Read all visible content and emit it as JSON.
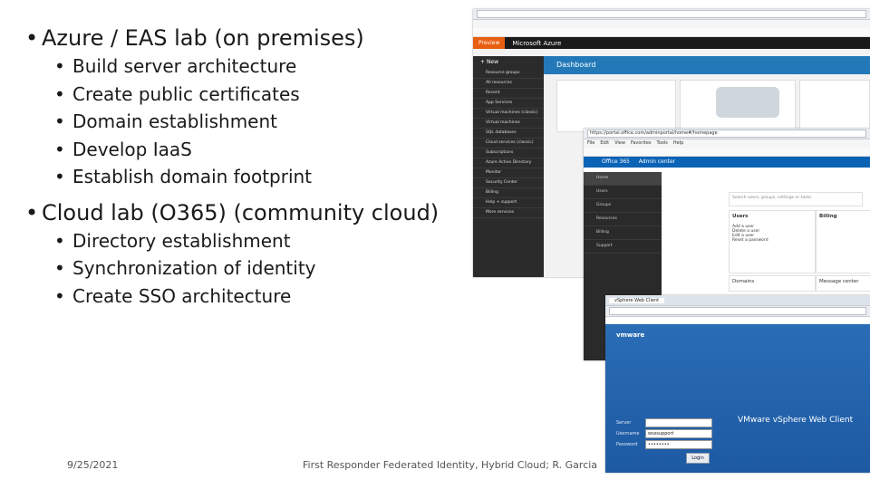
{
  "slide": {
    "bullet1": "Azure / EAS lab (on premises)",
    "sub1": [
      "Build server architecture",
      "Create public certificates",
      "Domain establishment",
      "Develop IaaS",
      "Establish domain footprint"
    ],
    "bullet2": "Cloud lab (O365) (community cloud)",
    "sub2": [
      "Directory establishment",
      "Synchronization of identity",
      "Create SSO architecture"
    ],
    "date": "9/25/2021",
    "footer": "First Responder Federated Identity, Hybrid Cloud; R. Garcia"
  },
  "azure": {
    "brand": "Microsoft Azure",
    "preview": "Preview",
    "dashboard": "Dashboard",
    "new": "New",
    "nav": [
      "Resource groups",
      "All resources",
      "Recent",
      "App Services",
      "Virtual machines (classic)",
      "Virtual machines",
      "SQL databases",
      "Cloud services (classic)",
      "Subscriptions",
      "Azure Active Directory",
      "Monitor",
      "Security Center",
      "Billing",
      "Help + support",
      "More services"
    ]
  },
  "o365": {
    "url": "https://portal.office.com/adminportal/home#/homepage",
    "menu": [
      "File",
      "Edit",
      "View",
      "Favorites",
      "Tools",
      "Help"
    ],
    "brand": "Office 365",
    "center": "Admin center",
    "home": "Home",
    "nav": [
      "Users",
      "Groups",
      "Resources",
      "Billing",
      "Support"
    ],
    "users_card": "Users",
    "users_actions": [
      "Add a user",
      "Delete a user",
      "Edit a user",
      "Reset a password"
    ],
    "billing_card": "Billing",
    "domains": "Domains",
    "message_center": "Message center",
    "search": "Search users, groups, settings or tasks"
  },
  "vsphere": {
    "tab": "vSphere Web Client",
    "brand": "vmware",
    "title": "VMware vSphere Web Client",
    "server_label": "Server",
    "username_label": "Username",
    "password_label": "Password",
    "username": "wsssupport",
    "password": "••••••••",
    "login": "Login"
  }
}
